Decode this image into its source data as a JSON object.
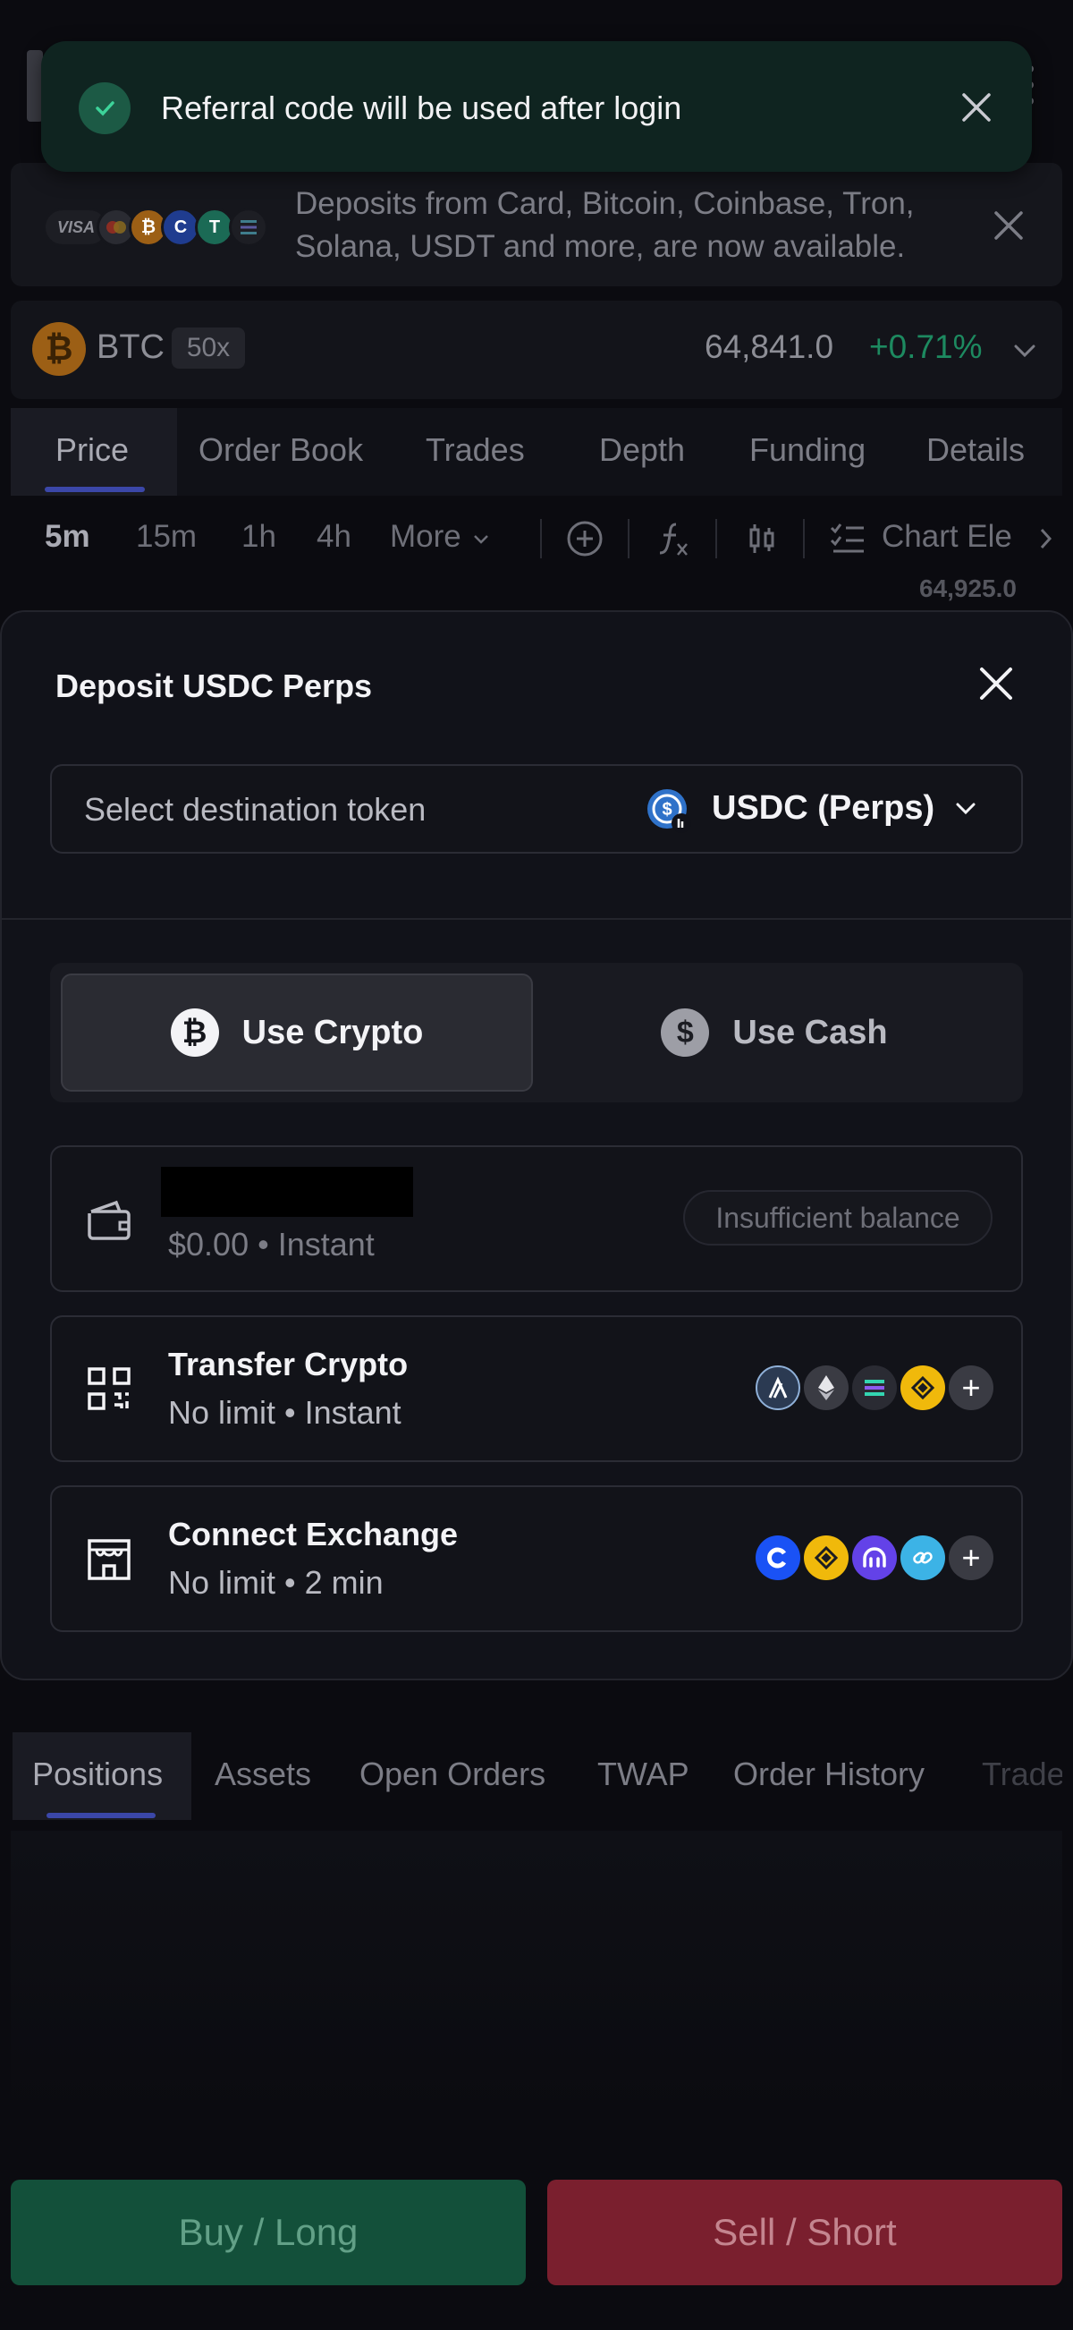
{
  "toast": {
    "message": "Referral code will be used after login"
  },
  "banner": {
    "text": "Deposits from Card, Bitcoin, Coinbase, Tron, Solana, USDT and more, are now available.",
    "visa_label": "VISA"
  },
  "ticker": {
    "symbol": "BTC",
    "leverage": "50x",
    "price": "64,841.0",
    "change": "+0.71%",
    "coin_glyph": "₿"
  },
  "chart_tabs": [
    "Price",
    "Order Book",
    "Trades",
    "Depth",
    "Funding",
    "Details"
  ],
  "intervals": [
    "5m",
    "15m",
    "1h",
    "4h",
    "More"
  ],
  "chart_elements_label": "Chart Ele",
  "chart_top_price": "64,925.0",
  "modal": {
    "title": "Deposit USDC Perps",
    "dest_label": "Select destination token",
    "dest_value": "USDC (Perps)",
    "use_crypto": "Use Crypto",
    "use_cash": "Use Cash",
    "wallet": {
      "sub": "$0.00 • Instant",
      "badge": "Insufficient balance"
    },
    "transfer": {
      "title": "Transfer Crypto",
      "sub": "No limit • Instant"
    },
    "exchange": {
      "title": "Connect Exchange",
      "sub": "No limit • 2 min"
    }
  },
  "bottom_tabs": [
    "Positions",
    "Assets",
    "Open Orders",
    "TWAP",
    "Order History",
    "Trade"
  ],
  "actions": {
    "buy": "Buy / Long",
    "sell": "Sell / Short"
  },
  "colors": {
    "positive": "#1d8a60",
    "buy": "#13503a",
    "sell": "#7a1f2e",
    "accent": "#3b47a8",
    "toast_bg": "#0f2420"
  }
}
